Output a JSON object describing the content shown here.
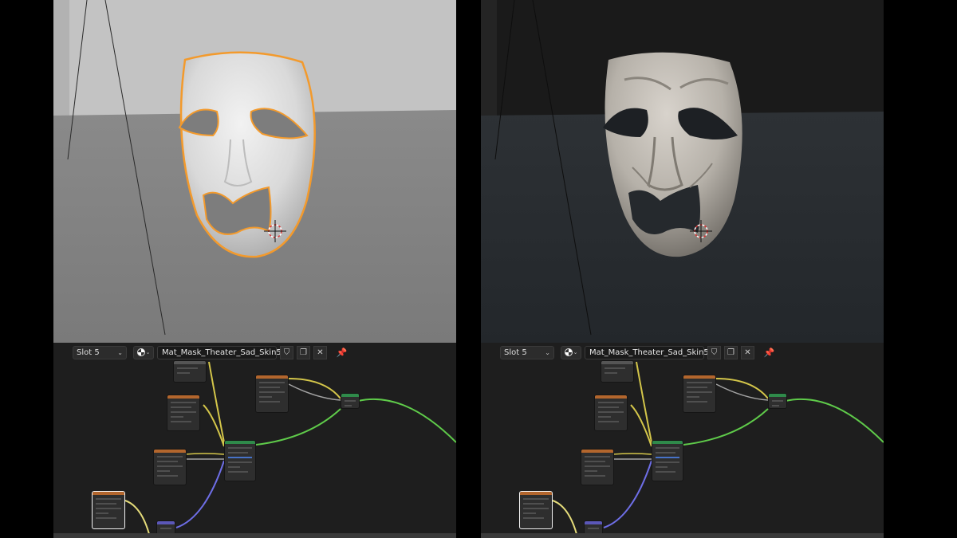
{
  "panels": [
    {
      "id": "left",
      "view_mode": "solid",
      "material_slot": "Slot 5",
      "material_name": "Mat_Mask_Theater_Sad_Skin5"
    },
    {
      "id": "right",
      "view_mode": "rendered",
      "material_slot": "Slot 5",
      "material_name": "Mat_Mask_Theater_Sad_Skin5"
    }
  ],
  "icons": {
    "chevron": "chevron-down-icon",
    "material": "material-sphere-icon",
    "fake_user": "shield-icon",
    "duplicate": "duplicate-icon",
    "unlink": "close-icon",
    "pin": "pin-icon"
  },
  "colors": {
    "selection_outline": "#f39a2c",
    "wire_yellow": "#d4c64a",
    "wire_gray": "#a3a3a3",
    "wire_green": "#5fcb4a",
    "wire_blue": "#6e6ee6",
    "node_header_texture": "#b3662d",
    "node_header_shader": "#2f8a4a"
  }
}
